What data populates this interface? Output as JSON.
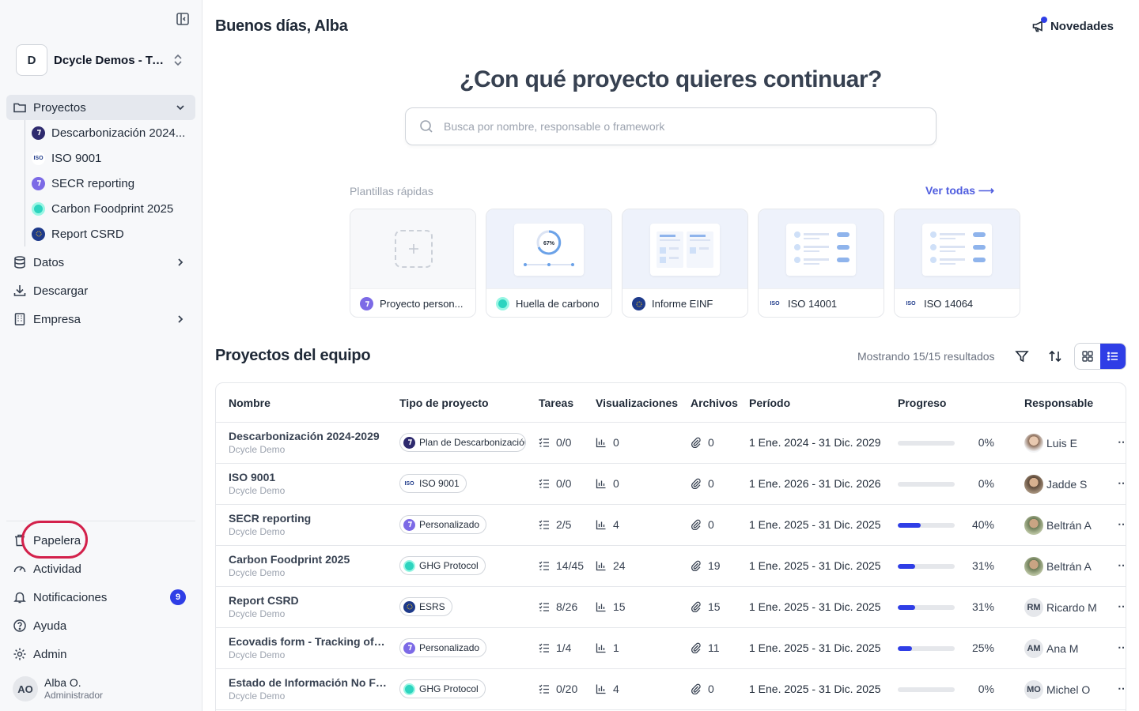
{
  "sidebar": {
    "org": {
      "initial": "D",
      "name": "Dcycle Demos - Tu..."
    },
    "projects_label": "Proyectos",
    "projects": [
      {
        "label": "Descarbonización 2024...",
        "logo": "dcycle"
      },
      {
        "label": "ISO 9001",
        "logo": "iso"
      },
      {
        "label": "SECR reporting",
        "logo": "purple"
      },
      {
        "label": "Carbon Foodprint 2025",
        "logo": "ghg"
      },
      {
        "label": "Report CSRD",
        "logo": "esrs"
      }
    ],
    "datos_label": "Datos",
    "descargar_label": "Descargar",
    "empresa_label": "Empresa",
    "papelera_label": "Papelera",
    "actividad_label": "Actividad",
    "notificaciones_label": "Notificaciones",
    "notificaciones_count": "9",
    "ayuda_label": "Ayuda",
    "admin_label": "Admin",
    "user": {
      "initials": "AO",
      "name": "Alba O.",
      "role": "Administrador"
    }
  },
  "header": {
    "greeting": "Buenos días, Alba",
    "news_label": "Novedades"
  },
  "hero": {
    "title": "¿Con qué proyecto quieres continuar?",
    "search_placeholder": "Busca por nombre, responsable o framework"
  },
  "templates": {
    "label": "Plantillas rápidas",
    "see_all": "Ver todas ⟶",
    "preview_percent": "67%",
    "items": [
      {
        "label": "Proyecto person...",
        "logo": "purple"
      },
      {
        "label": "Huella de carbono",
        "logo": "ghg"
      },
      {
        "label": "Informe EINF",
        "logo": "esrs"
      },
      {
        "label": "ISO 14001",
        "logo": "iso"
      },
      {
        "label": "ISO 14064",
        "logo": "iso"
      }
    ]
  },
  "team": {
    "title": "Proyectos del equipo",
    "results": "Mostrando 15/15 resultados",
    "columns": [
      "Nombre",
      "Tipo de proyecto",
      "Tareas",
      "Visualizaciones",
      "Archivos",
      "Período",
      "Progreso",
      "Responsable"
    ],
    "rows": [
      {
        "name": "Descarbonización 2024-2029",
        "org": "Dcycle Demo",
        "type": "Plan de Descarbonización",
        "logo": "dcycle",
        "tasks": "0/0",
        "views": "0",
        "files": "0",
        "period": "1 Ene. 2024 - 31 Dic. 2029",
        "progress": 0,
        "progress_label": "0%",
        "owner": "Luis E",
        "owner_initials": "",
        "owner_avatar": "photo1"
      },
      {
        "name": "ISO 9001",
        "org": "Dcycle Demo",
        "type": "ISO 9001",
        "logo": "iso",
        "tasks": "0/0",
        "views": "0",
        "files": "0",
        "period": "1 Ene. 2026 - 31 Dic. 2026",
        "progress": 0,
        "progress_label": "0%",
        "owner": "Jadde S",
        "owner_initials": "",
        "owner_avatar": "photo2"
      },
      {
        "name": "SECR reporting",
        "org": "Dcycle Demo",
        "type": "Personalizado",
        "logo": "purple",
        "tasks": "2/5",
        "views": "4",
        "files": "0",
        "period": "1 Ene. 2025 - 31 Dic. 2025",
        "progress": 40,
        "progress_label": "40%",
        "owner": "Beltrán A",
        "owner_initials": "",
        "owner_avatar": "photo3"
      },
      {
        "name": "Carbon Foodprint 2025",
        "org": "Dcycle Demo",
        "type": "GHG Protocol",
        "logo": "ghg",
        "tasks": "14/45",
        "views": "24",
        "files": "19",
        "period": "1 Ene. 2025 - 31 Dic. 2025",
        "progress": 31,
        "progress_label": "31%",
        "owner": "Beltrán A",
        "owner_initials": "",
        "owner_avatar": "photo3"
      },
      {
        "name": "Report CSRD",
        "org": "Dcycle Demo",
        "type": "ESRS",
        "logo": "esrs",
        "tasks": "8/26",
        "views": "15",
        "files": "15",
        "period": "1 Ene. 2025 - 31 Dic. 2025",
        "progress": 31,
        "progress_label": "31%",
        "owner": "Ricardo M",
        "owner_initials": "RM",
        "owner_avatar": "initials"
      },
      {
        "name": "Ecovadis form - Tracking of d...",
        "org": "Dcycle Demo",
        "type": "Personalizado",
        "logo": "purple",
        "tasks": "1/4",
        "views": "1",
        "files": "11",
        "period": "1 Ene. 2025 - 31 Dic. 2025",
        "progress": 25,
        "progress_label": "25%",
        "owner": "Ana M",
        "owner_initials": "AM",
        "owner_avatar": "initials"
      },
      {
        "name": "Estado de Información No Fin...",
        "org": "Dcycle Demo",
        "type": "GHG Protocol",
        "logo": "ghg",
        "tasks": "0/20",
        "views": "4",
        "files": "0",
        "period": "1 Ene. 2025 - 31 Dic. 2025",
        "progress": 0,
        "progress_label": "0%",
        "owner": "Michel O",
        "owner_initials": "MO",
        "owner_avatar": "initials"
      }
    ]
  },
  "colors": {
    "accent": "#2f3ee6",
    "highlight": "#d3214b",
    "link": "#4f5ddf"
  }
}
